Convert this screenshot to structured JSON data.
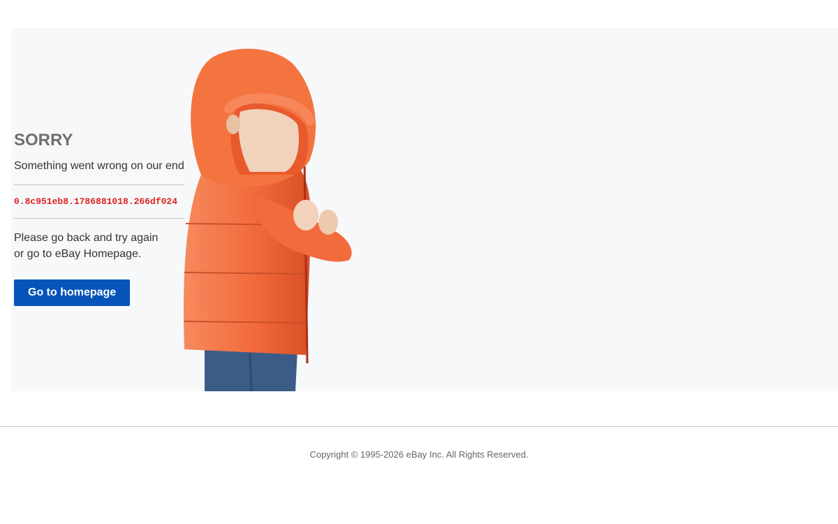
{
  "error": {
    "title": "SORRY",
    "subtitle": "Something went wrong on our end",
    "code": "0.8c951eb8.1786881018.266df024",
    "instructions_line1": "Please go back and try again",
    "instructions_line2": "or go to eBay Homepage."
  },
  "actions": {
    "home_button_label": "Go to homepage"
  },
  "footer": {
    "copyright": "Copyright © 1995-2026 eBay Inc. All Rights Reserved."
  },
  "illustration": {
    "icon": "child-in-orange-hooded-jacket-image"
  },
  "colors": {
    "accent": "#0654ba",
    "error_code": "#dd2222",
    "hero_background": "#f7f8fa",
    "jacket": "#f06a3d"
  }
}
